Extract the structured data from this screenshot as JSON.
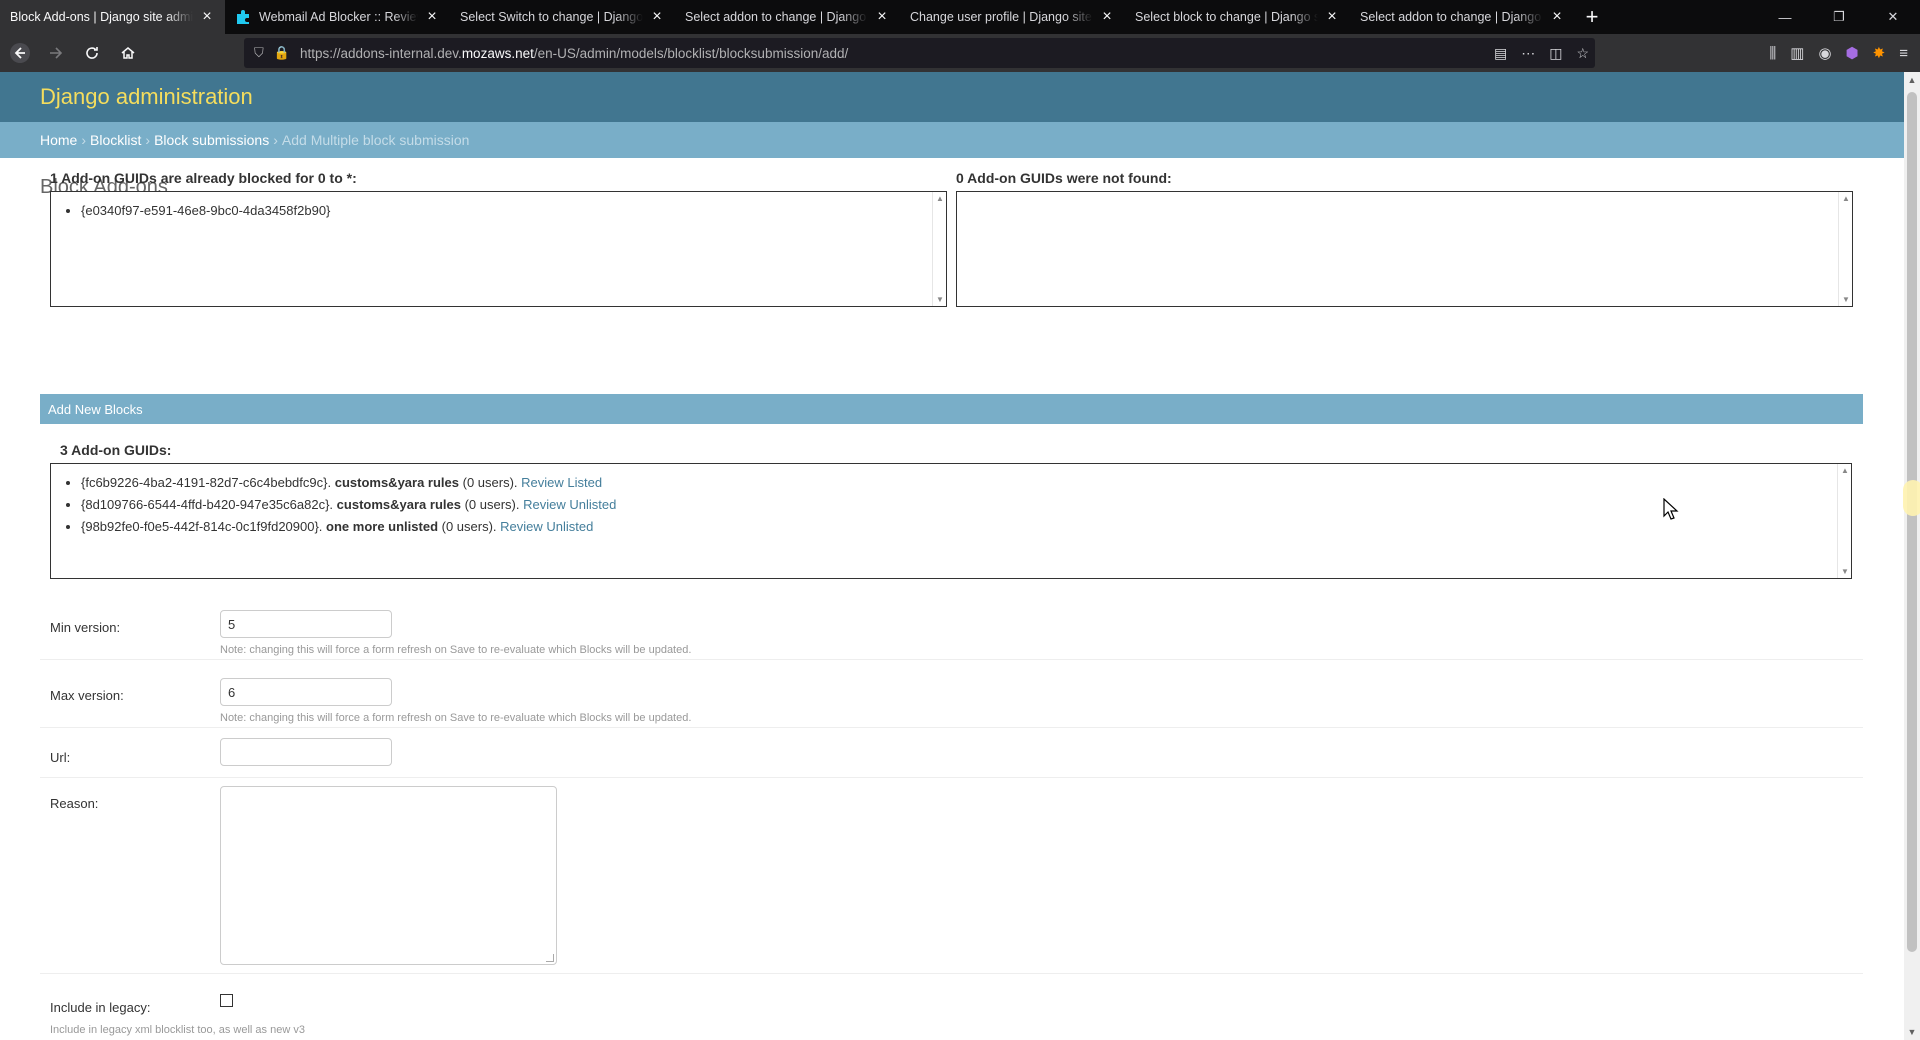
{
  "browser": {
    "tabs": [
      {
        "title": "Block Add-ons | Django site admin",
        "active": true
      },
      {
        "title": "Webmail Ad Blocker :: Reviewer Tools",
        "active": false
      },
      {
        "title": "Select Switch to change | Django site admin",
        "active": false
      },
      {
        "title": "Select addon to change | Django site admin",
        "active": false
      },
      {
        "title": "Change user profile | Django site admin",
        "active": false
      },
      {
        "title": "Select block to change | Django site admin",
        "active": false
      },
      {
        "title": "Select addon to change | Django site admin",
        "active": false
      }
    ],
    "url_prefix": "https://addons-internal.dev.",
    "url_host": "mozaws.net",
    "url_path": "/en-US/admin/models/blocklist/blocksubmission/add/"
  },
  "admin": {
    "brand": "Django administration",
    "breadcrumbs": {
      "home": "Home",
      "blocklist": "Blocklist",
      "submissions": "Block submissions",
      "current": "Add Multiple block submission"
    },
    "title": "Block Add-ons"
  },
  "existing": {
    "heading": "1 Add-on GUIDs are already blocked for 0 to *:",
    "items": [
      "{e0340f97-e591-46e8-9bc0-4da3458f2b90}"
    ]
  },
  "not_found": {
    "heading": "0 Add-on GUIDs were not found:"
  },
  "new_blocks": {
    "module_title": "Add New Blocks",
    "heading": "3 Add-on GUIDs:",
    "items": [
      {
        "guid": "{fc6b9226-4ba2-4191-82d7-c6c4bebdfc9c}.",
        "name": "customs&yara rules",
        "users": "(0 users).",
        "link": "Review Listed"
      },
      {
        "guid": "{8d109766-6544-4ffd-b420-947e35c6a82c}.",
        "name": "customs&yara rules",
        "users": "(0 users).",
        "link": "Review Unlisted"
      },
      {
        "guid": "{98b92fe0-f0e5-442f-814c-0c1f9fd20900}.",
        "name": "one more unlisted",
        "users": "(0 users).",
        "link": "Review Unlisted"
      }
    ]
  },
  "form": {
    "min_version": {
      "label": "Min version:",
      "value": "5",
      "help": "Note: changing this will force a form refresh on Save to re-evaluate which Blocks will be updated."
    },
    "max_version": {
      "label": "Max version:",
      "value": "6",
      "help": "Note: changing this will force a form refresh on Save to re-evaluate which Blocks will be updated."
    },
    "url": {
      "label": "Url:",
      "value": ""
    },
    "reason": {
      "label": "Reason:",
      "value": ""
    },
    "include_legacy": {
      "label": "Include in legacy:",
      "checked": false,
      "help": "Include in legacy xml blocklist too, as well as new v3"
    }
  },
  "colors": {
    "header": "#417690",
    "brand": "#f5dd5d",
    "breadcrumbs": "#79aec8",
    "link": "#447e9b"
  }
}
